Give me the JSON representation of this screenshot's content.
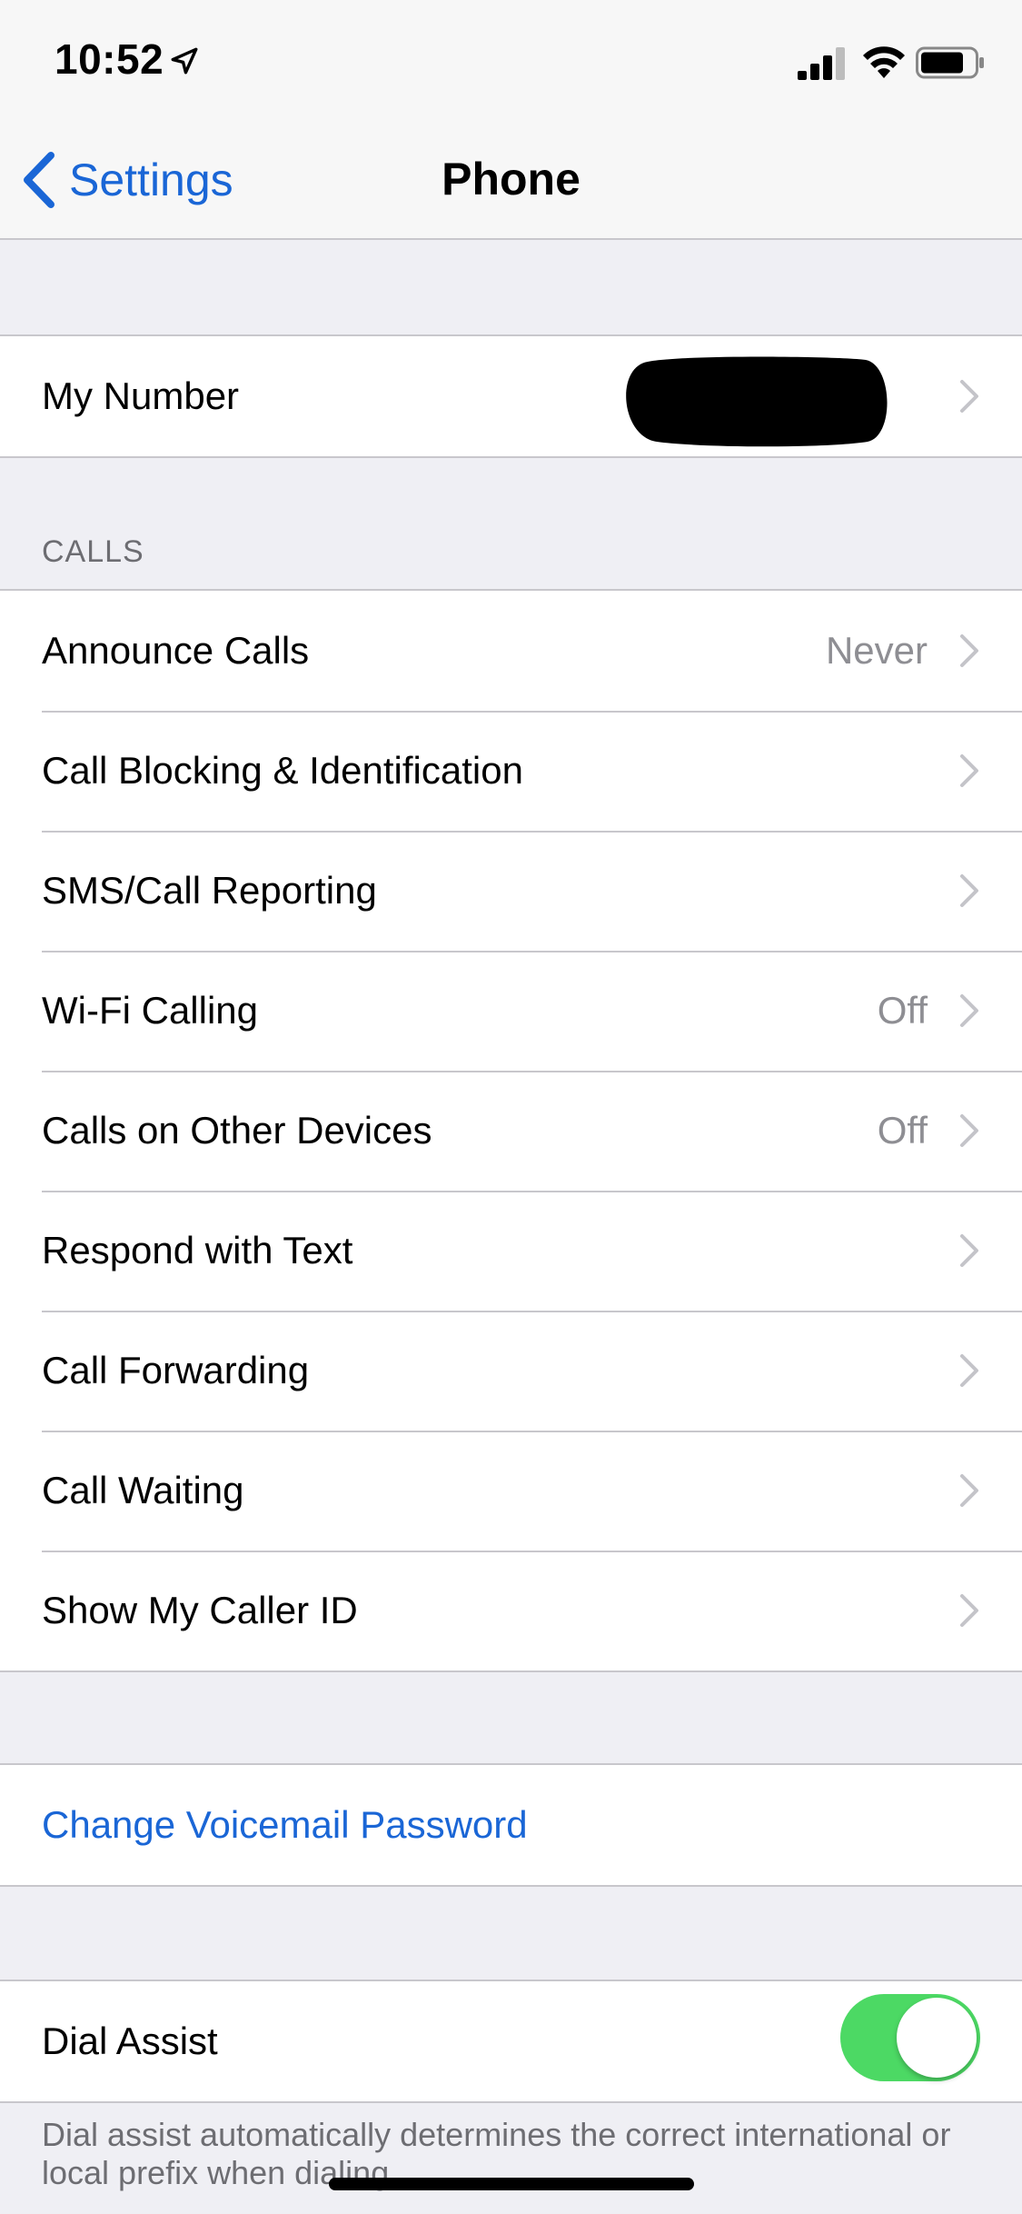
{
  "status_bar": {
    "time": "10:52",
    "icons": [
      "location-arrow-icon",
      "cellular-signal-icon",
      "wifi-icon",
      "battery-icon"
    ]
  },
  "nav": {
    "back_label": "Settings",
    "title": "Phone"
  },
  "my_number": {
    "label": "My Number"
  },
  "calls_section": {
    "header": "CALLS",
    "rows": [
      {
        "label": "Announce Calls",
        "value": "Never"
      },
      {
        "label": "Call Blocking & Identification",
        "value": ""
      },
      {
        "label": "SMS/Call Reporting",
        "value": ""
      },
      {
        "label": "Wi-Fi Calling",
        "value": "Off"
      },
      {
        "label": "Calls on Other Devices",
        "value": "Off"
      },
      {
        "label": "Respond with Text",
        "value": ""
      },
      {
        "label": "Call Forwarding",
        "value": ""
      },
      {
        "label": "Call Waiting",
        "value": ""
      },
      {
        "label": "Show My Caller ID",
        "value": ""
      }
    ]
  },
  "voicemail": {
    "label": "Change Voicemail Password"
  },
  "dial_assist": {
    "label": "Dial Assist",
    "enabled": true,
    "footer": "Dial assist automatically determines the correct international or local prefix when dialing."
  },
  "colors": {
    "accent": "#1a66d6",
    "toggle_on": "#4cd964",
    "background": "#efeff4",
    "separator": "#c8c7cc",
    "secondary_text": "#8e8e93"
  }
}
